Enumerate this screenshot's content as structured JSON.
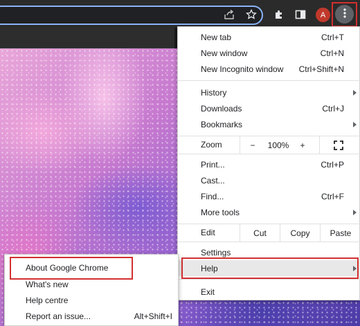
{
  "toolbar": {
    "icons": [
      "share-icon",
      "star-icon",
      "extensions-icon",
      "side-panel-icon",
      "kebab-menu-icon"
    ],
    "avatar_letter": "A",
    "avatar_color": "#c0392b",
    "highlight_color": "#d32f2f"
  },
  "menu": {
    "new_tab": {
      "label": "New tab",
      "shortcut": "Ctrl+T"
    },
    "new_window": {
      "label": "New window",
      "shortcut": "Ctrl+N"
    },
    "new_incognito": {
      "label": "New Incognito window",
      "shortcut": "Ctrl+Shift+N"
    },
    "history": {
      "label": "History"
    },
    "downloads": {
      "label": "Downloads",
      "shortcut": "Ctrl+J"
    },
    "bookmarks": {
      "label": "Bookmarks"
    },
    "zoom": {
      "label": "Zoom",
      "minus": "−",
      "level": "100%",
      "plus": "+"
    },
    "print": {
      "label": "Print...",
      "shortcut": "Ctrl+P"
    },
    "cast": {
      "label": "Cast..."
    },
    "find": {
      "label": "Find...",
      "shortcut": "Ctrl+F"
    },
    "more_tools": {
      "label": "More tools"
    },
    "edit": {
      "label": "Edit",
      "cut": "Cut",
      "copy": "Copy",
      "paste": "Paste"
    },
    "settings": {
      "label": "Settings"
    },
    "help": {
      "label": "Help"
    },
    "exit": {
      "label": "Exit"
    }
  },
  "help_submenu": {
    "about": {
      "label": "About Google Chrome"
    },
    "whats_new": {
      "label": "What's new"
    },
    "help_centre": {
      "label": "Help centre"
    },
    "report_issue": {
      "label": "Report an issue...",
      "shortcut": "Alt+Shift+I"
    }
  }
}
